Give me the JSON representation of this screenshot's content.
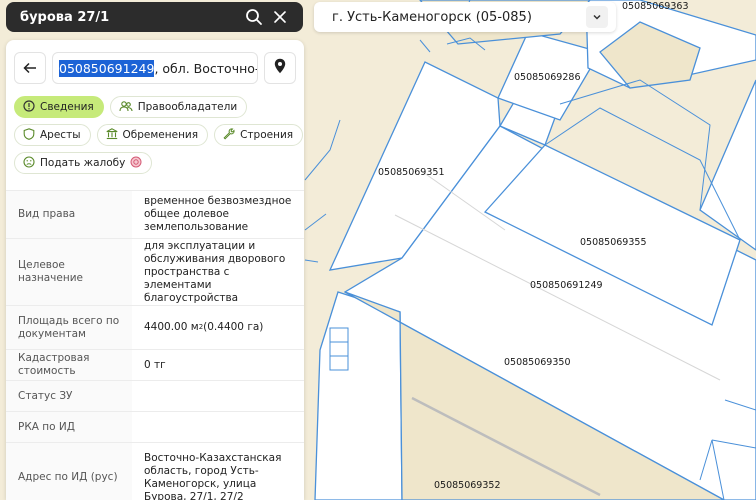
{
  "search": {
    "query": "бурова 27/1"
  },
  "region": {
    "selected": "г. Усть-Каменогорск (05-085)"
  },
  "panel": {
    "cadastre_selected": "050850691249",
    "address_rest": ", обл. Восточно-Ка",
    "chips": [
      {
        "label": "Сведения",
        "icon": "info-icon",
        "active": true
      },
      {
        "label": "Правообладатели",
        "icon": "people-icon"
      },
      {
        "label": "Аресты",
        "icon": "shield-icon"
      },
      {
        "label": "Обременения",
        "icon": "bank-icon"
      },
      {
        "label": "Строения",
        "icon": "wrench-icon"
      },
      {
        "label": "Подать жалобу",
        "icon": "sad-face-icon",
        "extra_icon": "alert-emoji-icon"
      }
    ],
    "rows": [
      {
        "key": "Вид права",
        "value": "временное безвозмездное общее долевое землепользование"
      },
      {
        "key": "Целевое назначение",
        "value": "для эксплуатации и обслуживания дворового пространства с элементами благоустройства"
      },
      {
        "key": "Площадь всего по документам",
        "value_main": "4400.00 м",
        "value_sup": "2",
        "value_tail": " (0.4400 га)"
      },
      {
        "key": "Кадастровая стоимость",
        "value": "0 тг"
      },
      {
        "key": "Статус ЗУ",
        "value": ""
      },
      {
        "key": "РКА по ИД",
        "value": ""
      },
      {
        "key": "Адрес по ИД (рус)",
        "value": "Восточно-Казахстанская область, город Усть-Каменогорск, улица Бурова, 27/1, 27/2"
      }
    ]
  },
  "map": {
    "parcel_labels": [
      "05085069363",
      "05085069286",
      "05085069351",
      "05085069355",
      "050850691249",
      "05085069350",
      "05085069352"
    ],
    "colors": {
      "outline": "#4a90d9",
      "bg": "#f3ecd8",
      "active_chip": "#c6ea7a"
    }
  }
}
